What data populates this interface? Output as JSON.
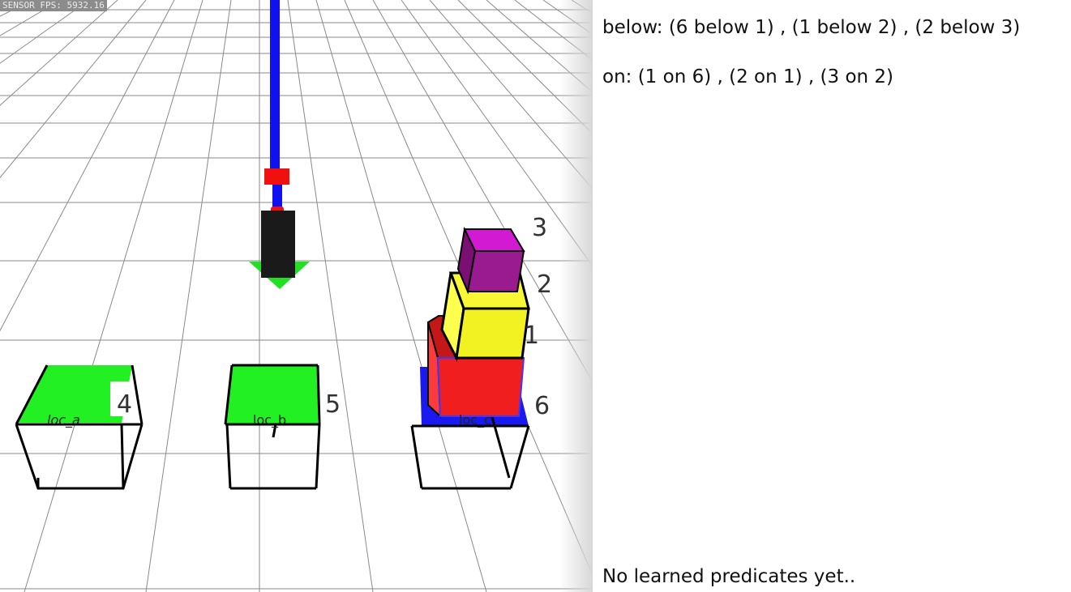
{
  "viewport": {
    "fps_text": "SENSOR FPS: 5932.16",
    "tables": [
      {
        "label": "loc_a",
        "number": "4"
      },
      {
        "label": "loc_b",
        "number": "5"
      },
      {
        "label": "loc_c",
        "number": "6"
      }
    ],
    "blocks": [
      {
        "number": "1",
        "color": "#f01e1e"
      },
      {
        "number": "2",
        "color": "#f2f222"
      },
      {
        "number": "3",
        "color": "#9a1a90"
      }
    ],
    "colors": {
      "table_top_green": "#22f022",
      "table_top_blue": "#1a1af0",
      "robot_arm": "#1010f0",
      "gripper": "#1a1a1a",
      "joint": "#f01010",
      "target_marker": "#22e022"
    }
  },
  "panel": {
    "below_text": "below: (6 below 1) , (1 below 2) , (2 below 3)",
    "on_text": "on: (1 on 6) , (2 on 1) , (3 on 2)",
    "learned_text": "No learned predicates yet.."
  }
}
